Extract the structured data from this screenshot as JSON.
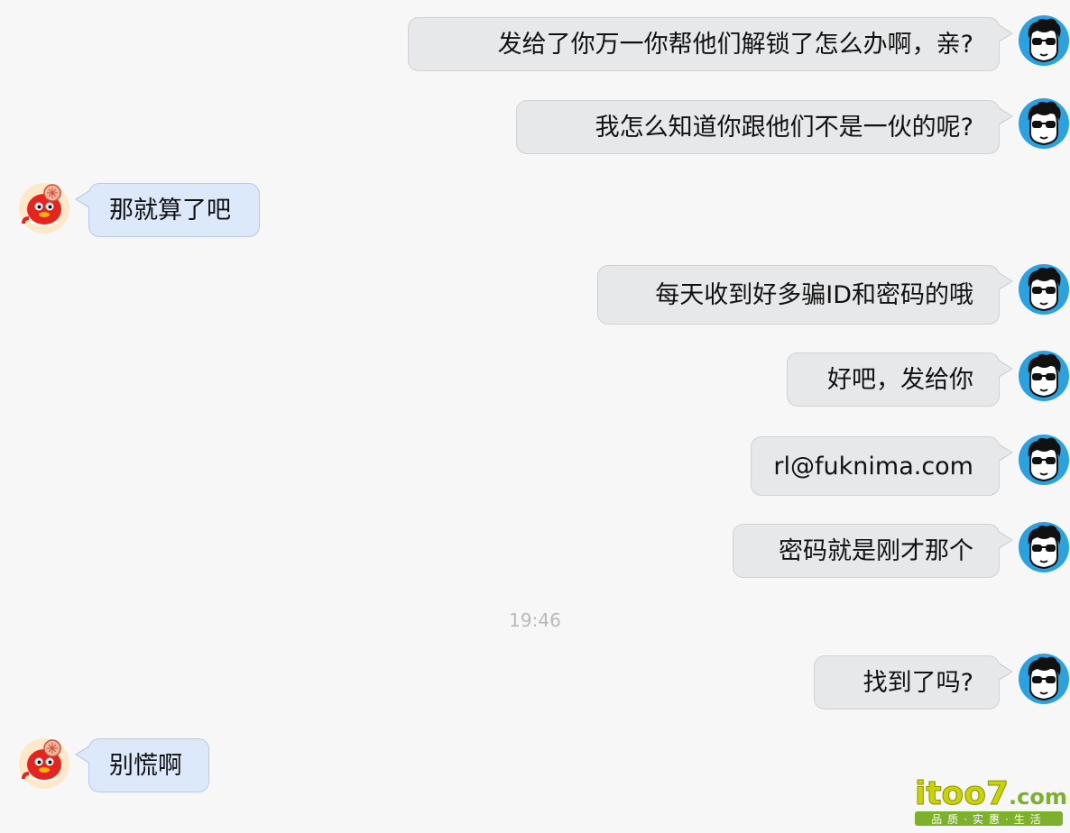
{
  "messages": [
    {
      "side": "out",
      "text": "发给了你万一你帮他们解锁了怎么办啊，亲?"
    },
    {
      "side": "out",
      "text": "我怎么知道你跟他们不是一伙的呢?"
    },
    {
      "side": "in",
      "text": "那就算了吧"
    },
    {
      "side": "out",
      "text": "每天收到好多骗ID和密码的哦"
    },
    {
      "side": "out",
      "text": "好吧，发给你"
    },
    {
      "side": "out",
      "text": "rl@fuknima.com"
    },
    {
      "side": "out",
      "text": "密码就是刚才那个"
    },
    {
      "side": "out",
      "text": "找到了吗?"
    },
    {
      "side": "in",
      "text": "别慌啊"
    }
  ],
  "timestamp": "19:46",
  "watermark": {
    "brand": "itoo7",
    "domain": ".com",
    "tagline": "品质·实惠·生活"
  },
  "colors": {
    "outgoing_bubble": "#e7e8ea",
    "incoming_bubble": "#dce9fb",
    "background": "#f7f7f7",
    "timestamp": "#b9b9b9"
  },
  "icons": {
    "self_avatar": "sunglasses-man-avatar",
    "contact_avatar": "red-mascot-avatar"
  }
}
